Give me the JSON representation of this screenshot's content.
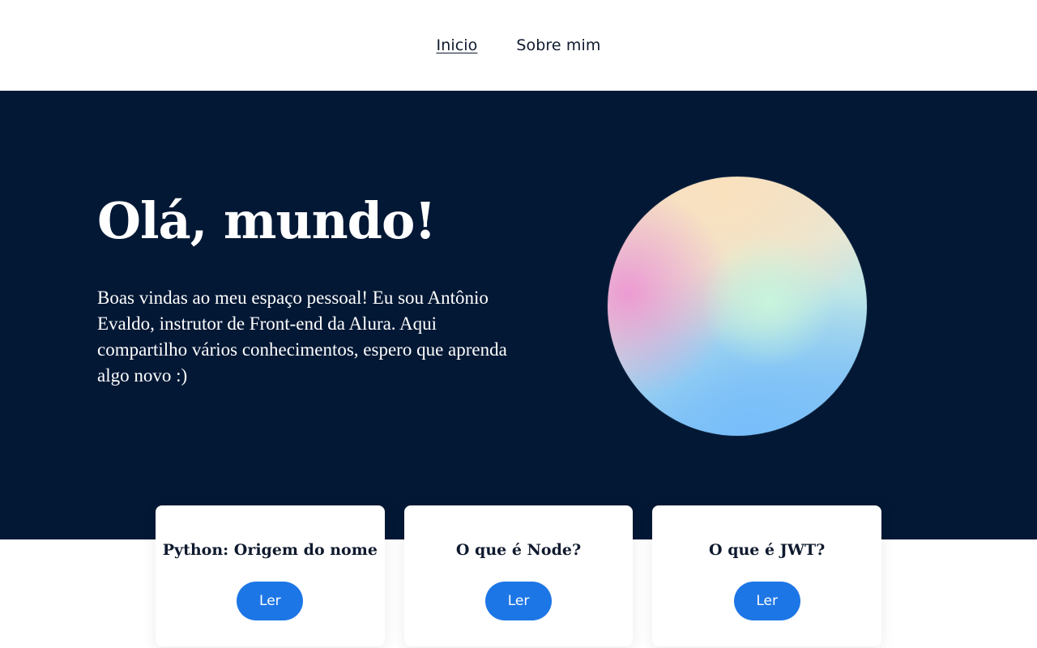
{
  "nav": {
    "items": [
      {
        "label": "Inicio",
        "active": true
      },
      {
        "label": "Sobre mim",
        "active": false
      }
    ]
  },
  "hero": {
    "title": "Olá, mundo!",
    "text": "Boas vindas ao meu espaço pessoal! Eu sou Antônio Evaldo, instrutor de Front-end da Alura. Aqui compartilho vários conhecimentos, espero que aprenda algo novo :)"
  },
  "cards": [
    {
      "title": "Python: Origem do nome",
      "button": "Ler"
    },
    {
      "title": "O que é Node?",
      "button": "Ler"
    },
    {
      "title": "O que é JWT?",
      "button": "Ler"
    }
  ],
  "colors": {
    "hero_background": "#031835",
    "button": "#1d76e6",
    "text_dark": "#0f1a2e"
  }
}
